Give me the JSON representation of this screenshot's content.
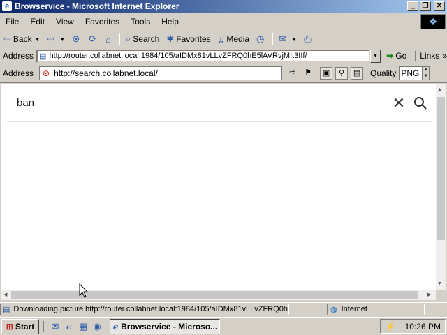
{
  "window": {
    "title": "Browservice - Microsoft Internet Explorer",
    "minimize": "_",
    "maximize": "❐",
    "close": "✕"
  },
  "menu": {
    "items": [
      "File",
      "Edit",
      "View",
      "Favorites",
      "Tools",
      "Help"
    ]
  },
  "toolbar": {
    "back": "Back",
    "search": "Search",
    "favorites": "Favorites",
    "media": "Media"
  },
  "address_bar": {
    "label": "Address",
    "url": "http://router.collabnet.local:1984/105/aIDMx81vLLvZFRQ0hE5lAVRvjMIt3IIf/",
    "go": "Go",
    "links": "Links"
  },
  "app_toolbar": {
    "address_label": "Address",
    "url": "http://search.collabnet.local/",
    "quality_label": "Quality",
    "quality_value": "PNG"
  },
  "page": {
    "search_value": "ban"
  },
  "status": {
    "text": "Downloading picture http://router.collabnet.local:1984/105/aIDMx81vLLvZFRQ0h",
    "zone": "Internet"
  },
  "taskbar": {
    "start": "Start",
    "task": "Browservice - Microso...",
    "clock": "10:26 PM"
  }
}
